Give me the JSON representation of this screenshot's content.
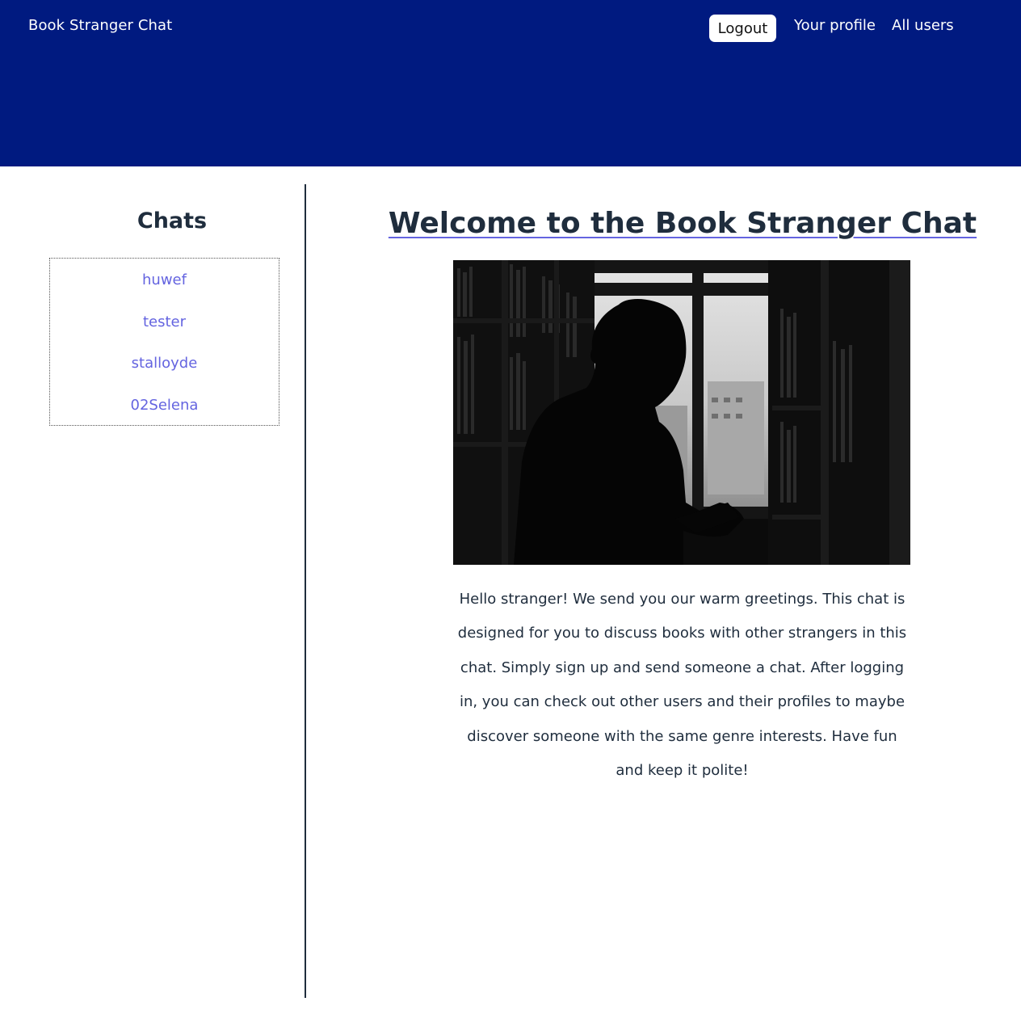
{
  "header": {
    "brand": "Book Stranger Chat",
    "logout_label": "Logout",
    "profile_label": "Your profile",
    "users_label": "All users",
    "background_color": "#001a80"
  },
  "sidebar": {
    "title": "Chats",
    "chats": [
      "huwef",
      "tester",
      "stalloyde",
      "02Selena"
    ],
    "link_color": "#6464e0"
  },
  "main": {
    "title": "Welcome to the Book Stranger Chat",
    "hero_icon": "person-reading-in-library-photo",
    "intro": "Hello stranger! We send you our warm greetings. This chat is designed for you to discuss books with other strangers in this chat. Simply sign up and send someone a chat. After logging in, you can check out other users and their profiles to maybe discover someone with the same genre interests. Have fun and keep it polite!"
  }
}
